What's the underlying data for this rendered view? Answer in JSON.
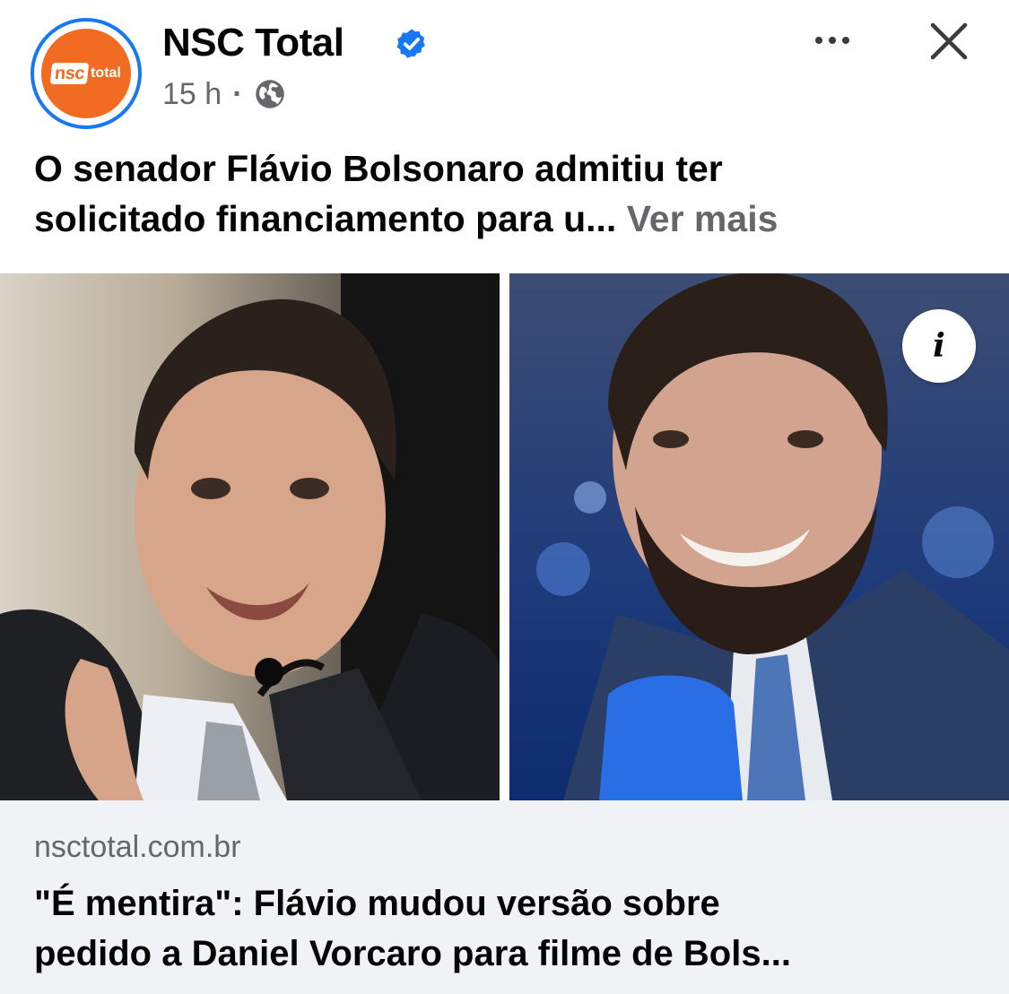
{
  "post": {
    "page_name": "NSC Total",
    "logo": {
      "part1": "nsc",
      "part2": "total"
    },
    "time": "15 h",
    "separator": "·",
    "caption_line1": "O senador Flávio Bolsonaro admitiu ter",
    "caption_line2": "solicitado financiamento para u...",
    "see_more": "Ver mais",
    "info_label": "i",
    "icons": [
      "verified-badge-icon",
      "globe-icon",
      "more-options-icon",
      "close-icon",
      "info-icon"
    ]
  },
  "link_preview": {
    "domain": "nsctotal.com.br",
    "title_line1": "\"É mentira\": Flávio mudou versão sobre",
    "title_line2": "pedido a Daniel Vorcaro para filme de Bols..."
  },
  "colors": {
    "brand_orange": "#f26b22",
    "facebook_blue": "#1877f2",
    "secondary_text": "#65676b",
    "link_box_bg": "#f0f2f5"
  }
}
